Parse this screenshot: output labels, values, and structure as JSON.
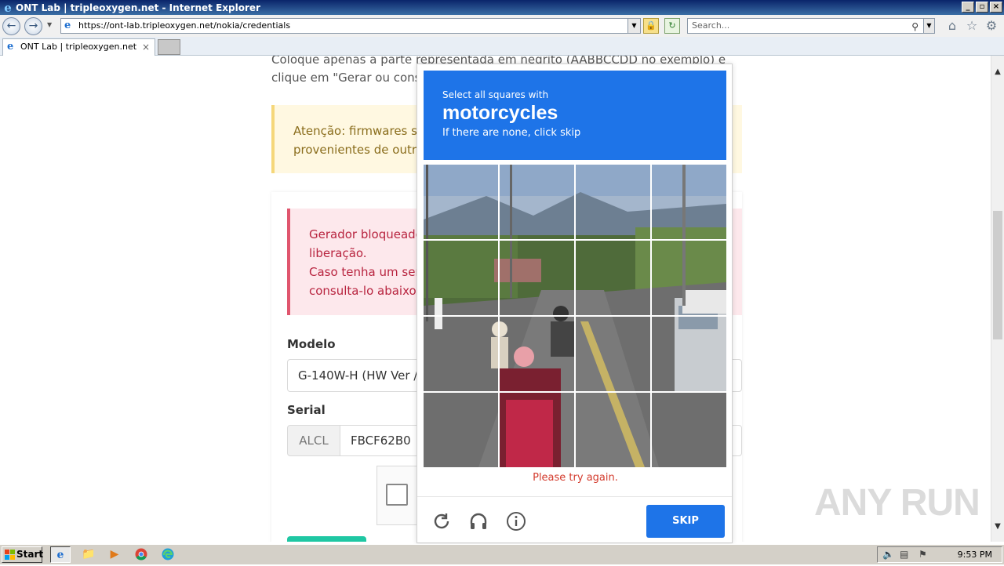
{
  "window": {
    "title": "ONT Lab | tripleoxygen.net - Internet Explorer",
    "buttons": {
      "minimize": "_",
      "maximize": "▫",
      "close": "×"
    }
  },
  "address": {
    "url": "https://ont-lab.tripleoxygen.net/nokia/credentials"
  },
  "search": {
    "placeholder": "Search..."
  },
  "tab": {
    "title": "ONT Lab | tripleoxygen.net"
  },
  "page": {
    "intro_line1": "Coloque apenas a parte representada em negrito (AABBCCDD no exemplo) e",
    "intro_line2": "clique em \"Gerar ou consu",
    "warning_line1": "Atenção: firmwares ser",
    "warning_line2": "provenientes de outro",
    "danger_line1": "Gerador bloqueado",
    "danger_line2": "liberação.",
    "danger_line3": "Caso tenha um seria",
    "danger_line4": "consulta-lo abaixo s",
    "modelo_label": "Modelo",
    "modelo_value": "G-140W-H (HW Ver /",
    "serial_label": "Serial",
    "serial_prefix": "ALCL",
    "serial_value": "FBCF62B0"
  },
  "captcha": {
    "instruction": "Select all squares with",
    "target": "motorcycles",
    "hint": "If there are none, click skip",
    "error": "Please try again.",
    "skip_label": "SKIP",
    "colors": {
      "prompt_bg": "#1e74e8",
      "error": "#d33a2c"
    }
  },
  "watermark": "ANY RUN",
  "taskbar": {
    "start_label": "Start",
    "time": "9:53 PM",
    "apps": [
      "internet-explorer",
      "file-explorer",
      "media-player",
      "chrome",
      "edge"
    ]
  }
}
